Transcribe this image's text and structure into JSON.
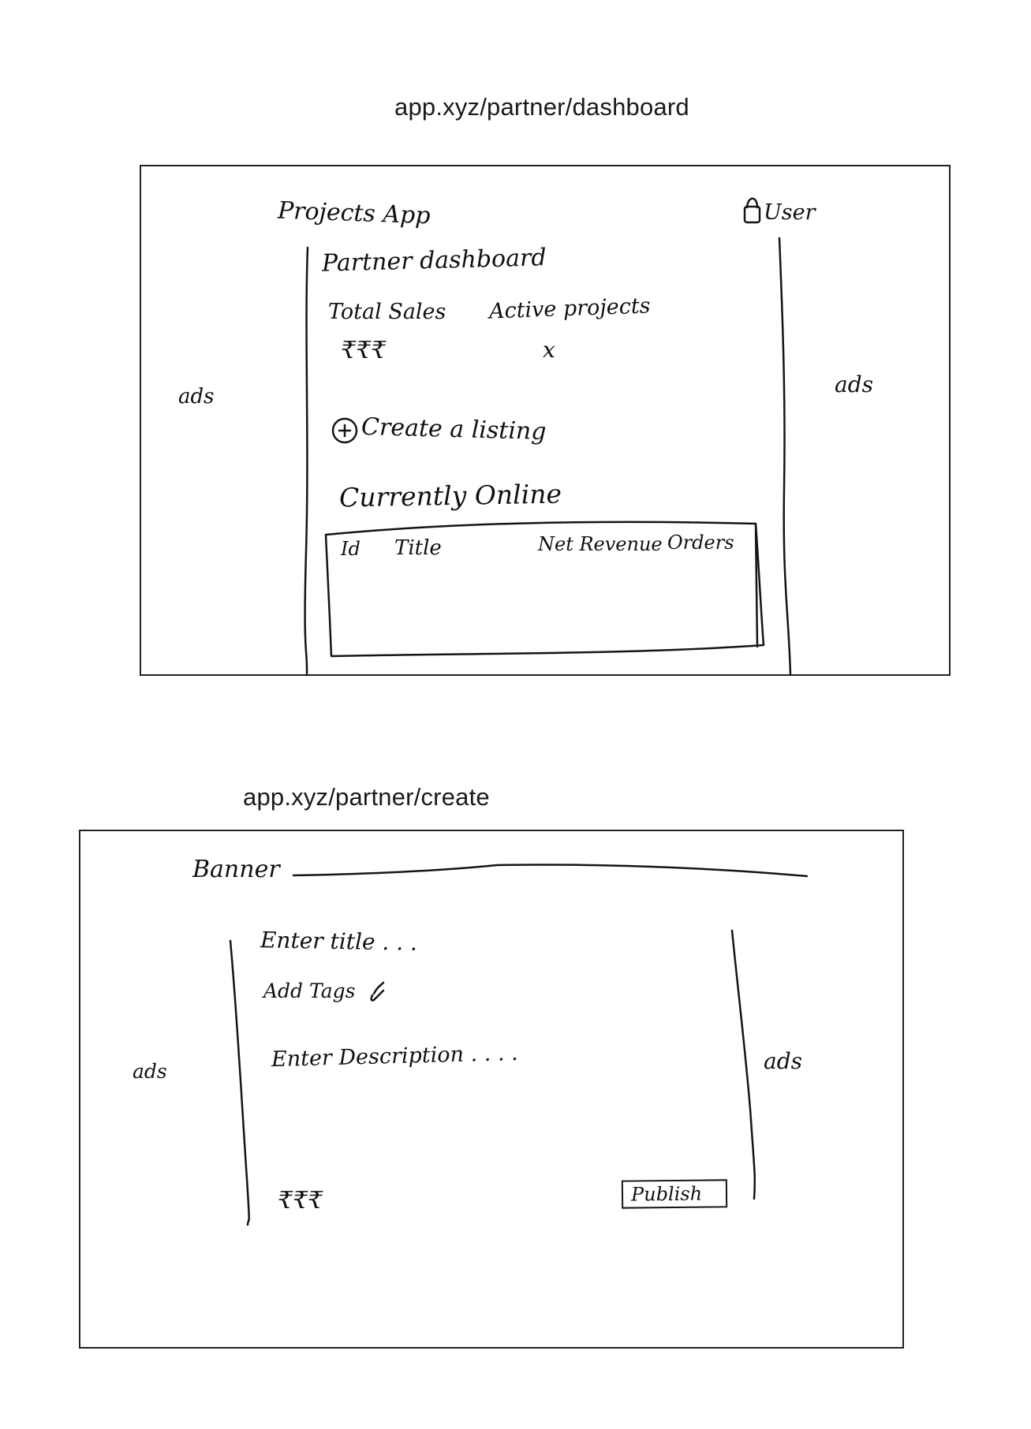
{
  "screens": {
    "dashboard": {
      "url": "app.xyz/partner/dashboard",
      "app_title": "Projects App",
      "user_label": "User",
      "page_title": "Partner dashboard",
      "stats": [
        {
          "label": "Total Sales",
          "value": "₹₹₹"
        },
        {
          "label": "Active projects",
          "value": "x"
        }
      ],
      "create_listing_label": "Create a listing",
      "section_title": "Currently Online",
      "table": {
        "columns": [
          "Id",
          "Title",
          "Net Revenue",
          "Orders"
        ],
        "rows": []
      },
      "left_ad": "ads",
      "right_ad": "ads"
    },
    "create": {
      "url": "app.xyz/partner/create",
      "banner_label": "Banner",
      "title_placeholder": "Enter title . . .",
      "tags_label": "Add Tags",
      "description_placeholder": "Enter Description . . . .",
      "price_value": "₹₹₹",
      "publish_label": "Publish",
      "left_ad": "ads",
      "right_ad": "ads"
    }
  },
  "icons": {
    "user": "user-icon",
    "add": "plus-circle-icon",
    "tags": "pencil-icon"
  }
}
